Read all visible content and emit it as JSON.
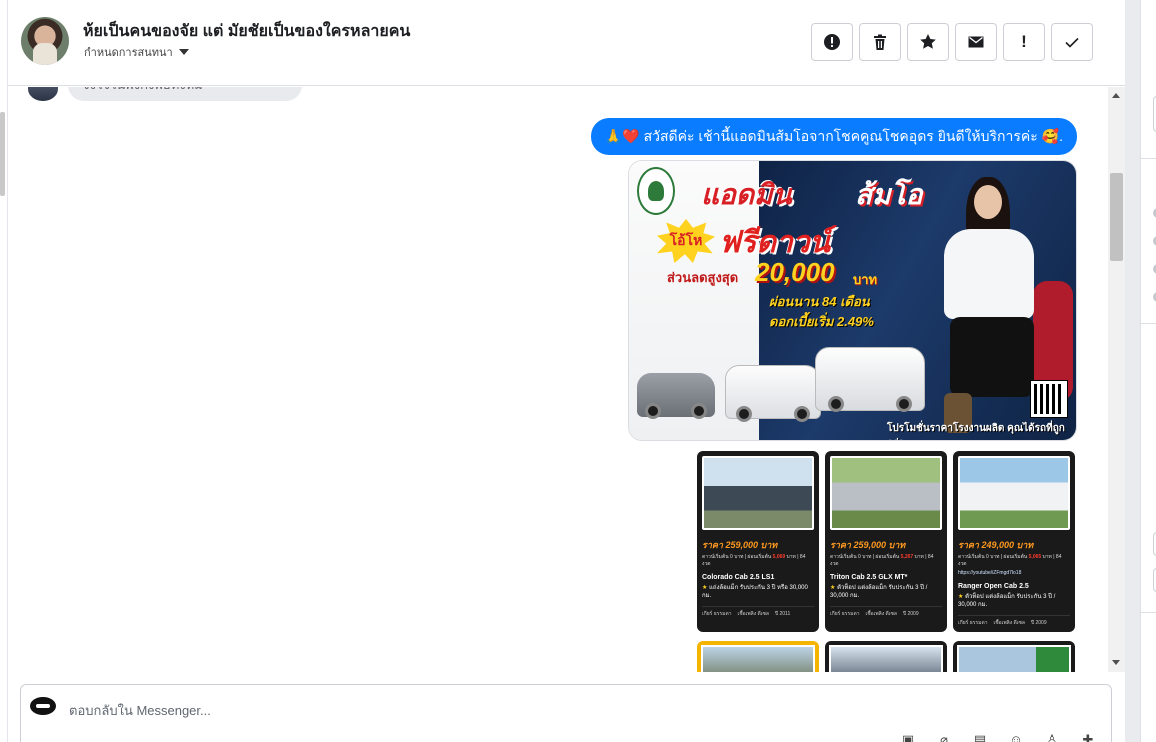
{
  "header": {
    "title": "ห้ยเป็นคนของจัย แต่ มัยชัยเป็นของใครหลายคน",
    "subtitle": "กำหนดการสนทนา",
    "actions": [
      {
        "name": "report-button",
        "icon": "exclamation-circle-icon"
      },
      {
        "name": "delete-button",
        "icon": "trash-icon"
      },
      {
        "name": "star-button",
        "icon": "star-icon"
      },
      {
        "name": "mark-unread-button",
        "icon": "envelope-icon"
      },
      {
        "name": "priority-button",
        "icon": "exclamation-icon",
        "label": "!"
      },
      {
        "name": "done-button",
        "icon": "check-icon"
      }
    ]
  },
  "thread": {
    "incoming_preview": "จิงใจในพิงกิงพิธีทั้งหม",
    "outgoing_message": "🙏❤️ สวัสดีค่ะ เช้านี้แอดมินส้มโอจากโชคคูณโชคอุดร ยินดีให้บริการค่ะ 🥰.",
    "promo": {
      "headline_1": "แอดมิน",
      "headline_2": "ส้มโอ",
      "burst": "โอ้โห",
      "headline_3": "ฟรีดาวน์",
      "discount_label": "ส่วนลดสูงสุด",
      "discount_amount": "20,000",
      "discount_unit": "บาท",
      "installment": "ผ่อนนาน 84 เดือน",
      "interest": "ดอกเบี้ยเริ่ม 2.49%",
      "footer": "โปรโมชั่นราคาโรงงานผลิต คุณได้รถที่ถูกกว่า"
    },
    "cars": [
      {
        "price": "ราคา 259,000 บาท",
        "finance_a": "ดาวน์เริ่มต้น 0 บาท | ผ่อนเริ่มต้น ",
        "finance_b": "5,069",
        "finance_c": " บาท | 84 งวด",
        "model": "Colorado Cab 2.5 LS1",
        "warranty": "แถ่งล้อแม็ก รับประกัน 3 ปี หรือ 30,000 กม.",
        "meta": [
          "เกียร์ ธรรมดา",
          "เชื้อเพลิง ดีเซล",
          "ปี 2011"
        ]
      },
      {
        "price": "ราคา 259,000 บาท",
        "finance_a": "ดาวน์เริ่มต้น 0 บาท | ผ่อนเริ่มต้น ",
        "finance_b": "5,267",
        "finance_c": " บาท | 84 งวด",
        "model": "Triton Cab 2.5 GLX MT*",
        "warranty": "ตัวท็อป แต่งล้อแม็ก รับประกัน 3 ปี / 30,000 กม.",
        "meta": [
          "เกียร์ ธรรมดา",
          "เชื้อเพลิง ดีเซล",
          "ปี 2009"
        ]
      },
      {
        "price": "ราคา 249,000 บาท",
        "finance_a": "ดาวน์เริ่มต้น 0 บาท | ผ่อนเริ่มต้น ",
        "finance_b": "5,065",
        "finance_c": " บาท | 84 งวด",
        "link": "https://youtube/iZFmgd7lo18",
        "model": "Ranger Open Cab 2.5",
        "warranty": "ตัวท็อป แต่งล้อแม็ก รับประกัน 3 ปี / 30,000 กม.",
        "meta": [
          "เกียร์ ธรรมดา",
          "เชื้อเพลิง ดีเซล",
          "ปี 2009"
        ]
      }
    ]
  },
  "composer": {
    "placeholder": "ตอบกลับใน Messenger...",
    "tools": [
      "sticker-icon",
      "attach-icon",
      "gif-icon",
      "emoji-icon",
      "like-icon",
      "thumbs-up-icon"
    ]
  },
  "colors": {
    "accent": "#0a7cff",
    "bubble_in": "#e9eaed"
  }
}
